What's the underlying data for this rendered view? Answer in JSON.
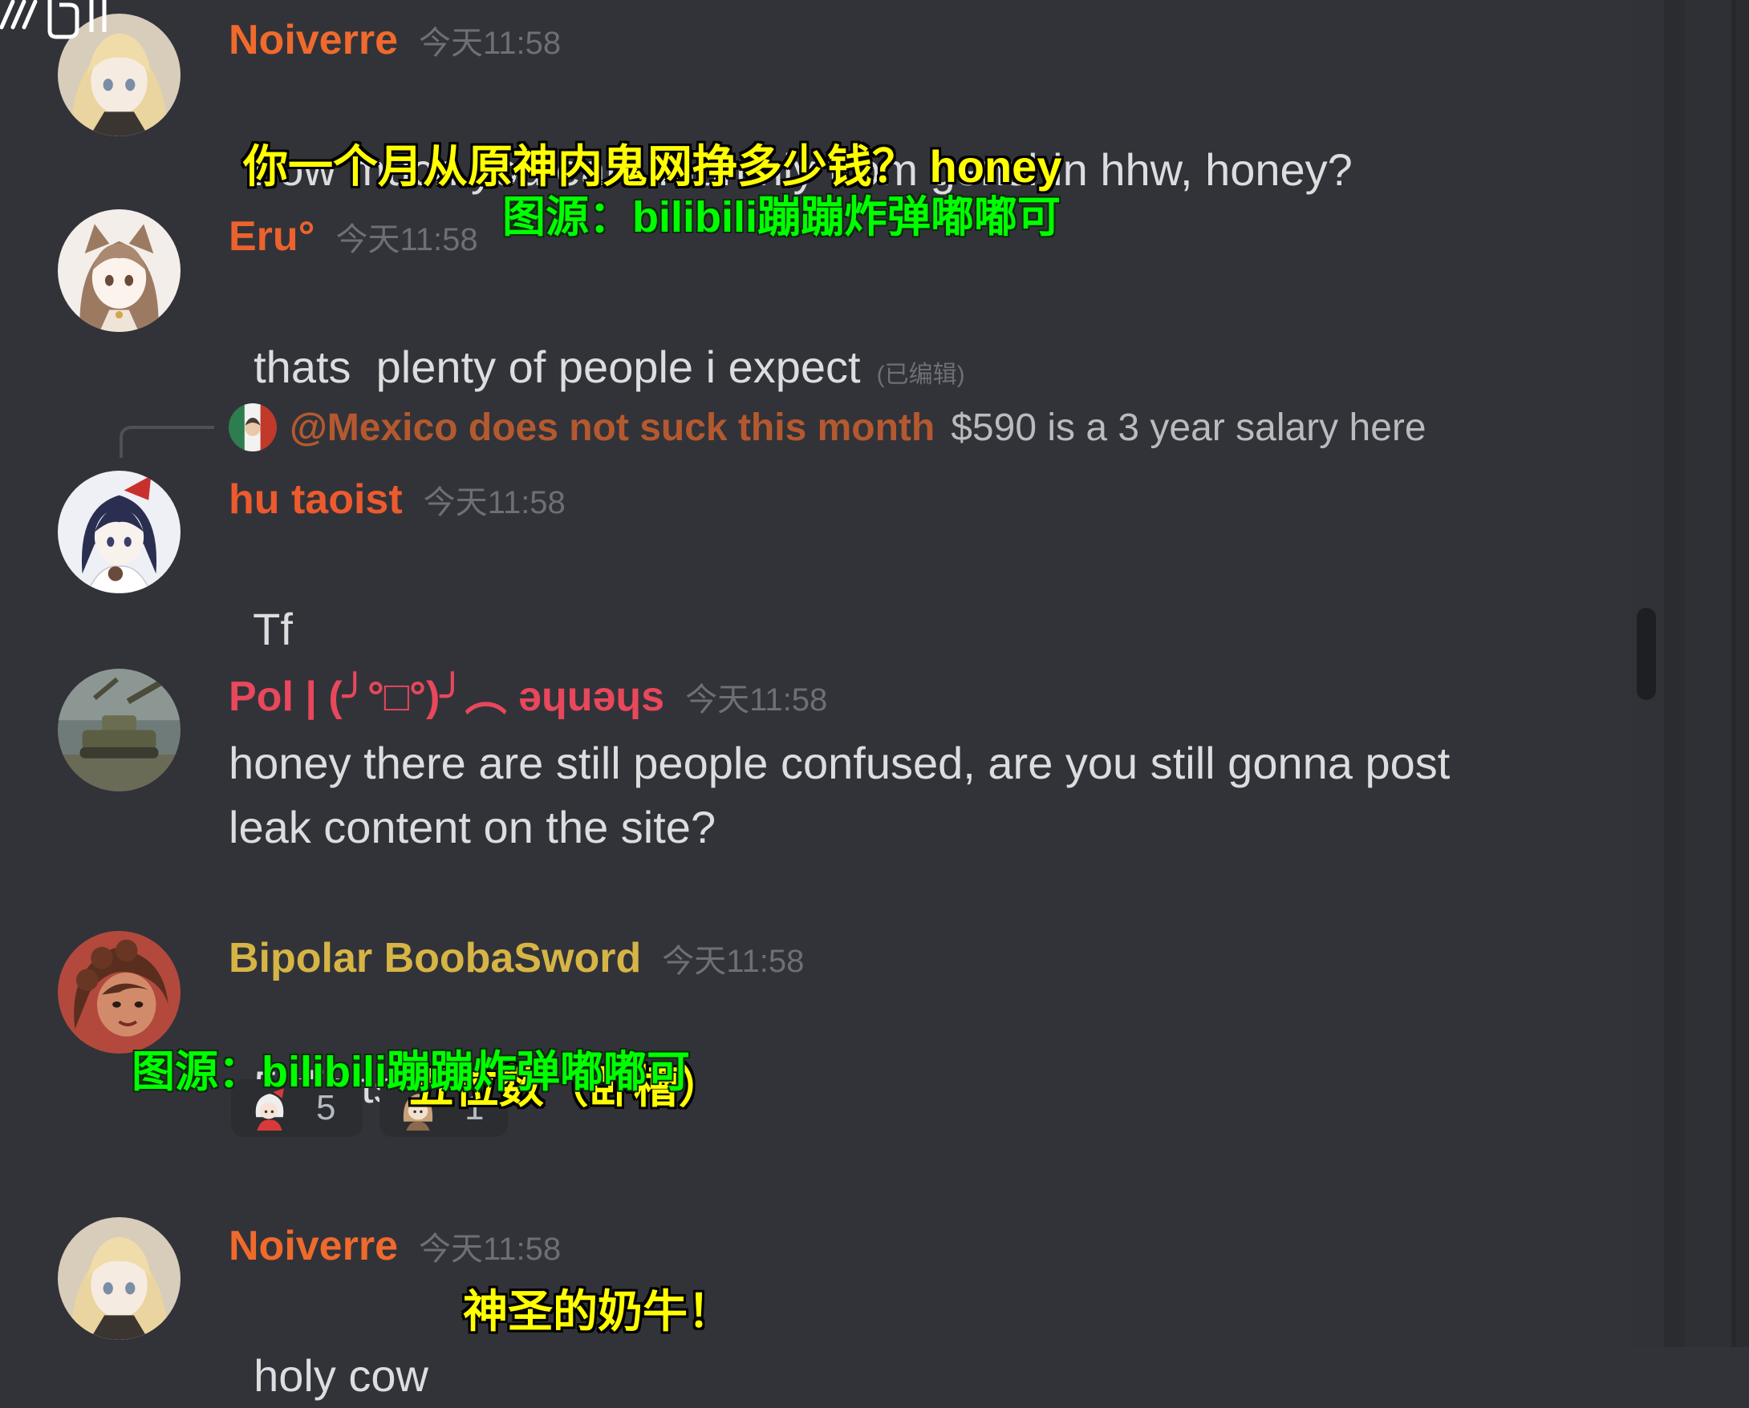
{
  "theme": {
    "background": "#323339",
    "message_text": "#dcddde",
    "muted": "#6d6f77"
  },
  "watermark": {
    "logo_icon": "bilibili-logo"
  },
  "messages": [
    {
      "avatar_icon": "anime-girl-blonde-avatar",
      "username": "Noiverre",
      "username_color": "#f06a2c",
      "timestamp": "今天11:58",
      "text": "how much you earn monthly from genshin hhw, honey?"
    },
    {
      "avatar_icon": "anime-girl-brown-hair-avatar",
      "username": "Eru°",
      "username_color": "#ec622d",
      "timestamp": "今天11:58",
      "text": "thats  plenty of people i expect",
      "edited": "(已编辑)"
    },
    {
      "avatar_icon": "anime-girl-dark-hair-avatar",
      "username": "hu taoist",
      "username_color": "#ec5a2d",
      "timestamp": "今天11:58",
      "text": "Tf",
      "reply": {
        "avatar_icon": "reply-user-avatar",
        "mention": "@Mexico does not suck this month",
        "mention_color": "#b4592f",
        "text": "$590 is a 3 year salary here"
      }
    },
    {
      "avatar_icon": "tank-avatar",
      "username": "Pol | (╯°□°)╯︵ ǝɥuǝɥs",
      "username_color": "#e8475c",
      "timestamp": "今天11:58",
      "text": "honey there are still people confused, are you still gonna post leak content on the site?"
    },
    {
      "avatar_icon": "anime-character-red-avatar",
      "username": "Bipolar BoobaSword",
      "username_color": "#d6b545",
      "timestamp": "今天11:58",
      "text": "5 digits",
      "reactions": [
        {
          "emoji": "custom-character-emoji",
          "count": "5"
        },
        {
          "emoji": "custom-character-emoji",
          "count": "1"
        }
      ]
    },
    {
      "avatar_icon": "anime-girl-blonde-avatar",
      "username": "Noiverre",
      "username_color": "#f06a2c",
      "timestamp": "今天11:58",
      "text": "holy cow"
    }
  ],
  "overlays": {
    "subtitle_color": "#ffff00",
    "source_color": "#00ff00",
    "msg1_subtitle": "你一个月从原神内鬼网挣多少钱？ honey",
    "source_credit_1": "图源：bilibili蹦蹦炸弹嘟嘟可",
    "msg5_subtitle": "五位数（卧槽）",
    "source_credit_2": "图源：bilibili蹦蹦炸弹嘟嘟可",
    "msg6_subtitle": "神圣的奶牛！"
  }
}
